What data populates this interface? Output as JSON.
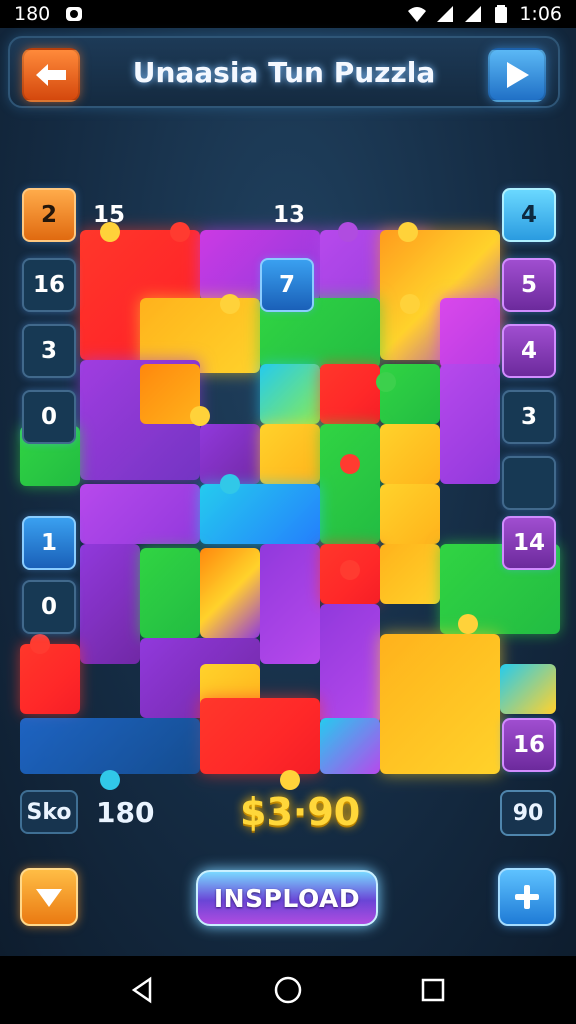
{
  "status_bar": {
    "left_number": "180",
    "time": "1:06",
    "icons": [
      "app-notification-icon",
      "wifi-icon",
      "signal-icon",
      "signal-icon",
      "battery-icon"
    ]
  },
  "header": {
    "title": "Unaasia Tun Puzzla",
    "back_icon": "arrow-left-icon",
    "next_icon": "play-right-icon"
  },
  "board": {
    "tiles": [
      {
        "label": "2",
        "style": "orange"
      },
      {
        "label": "15",
        "style": "clear"
      },
      {
        "label": "13",
        "style": "clear"
      },
      {
        "label": "4",
        "style": "cyan"
      },
      {
        "label": "16",
        "style": "dark"
      },
      {
        "label": "7",
        "style": "blue"
      },
      {
        "label": "5",
        "style": "purple"
      },
      {
        "label": "3",
        "style": "dark"
      },
      {
        "label": "4",
        "style": "purple"
      },
      {
        "label": "0",
        "style": "dark"
      },
      {
        "label": "3",
        "style": "dark"
      },
      {
        "label": "1",
        "style": "blue"
      },
      {
        "label": "14",
        "style": "purple"
      },
      {
        "label": "0",
        "style": "dark"
      },
      {
        "label": "16",
        "style": "purple"
      }
    ],
    "colors": {
      "red": "#f2322b",
      "orange": "#ff8a1a",
      "yellow": "#ffd23a",
      "green": "#35c84a",
      "purple": "#8c3cd0",
      "blue": "#2b7ef0",
      "cyan": "#31c8e8",
      "pink": "#d04ce0"
    }
  },
  "stats": {
    "score_label": "Sko",
    "score_value": "180",
    "money": "$3·90",
    "moves": "90"
  },
  "controls": {
    "down_icon": "arrow-down-icon",
    "main_button": "INSPLOAD",
    "plus_icon": "plus-icon"
  },
  "nav": {
    "icons": [
      "back-triangle-icon",
      "home-circle-icon",
      "recents-square-icon"
    ]
  }
}
